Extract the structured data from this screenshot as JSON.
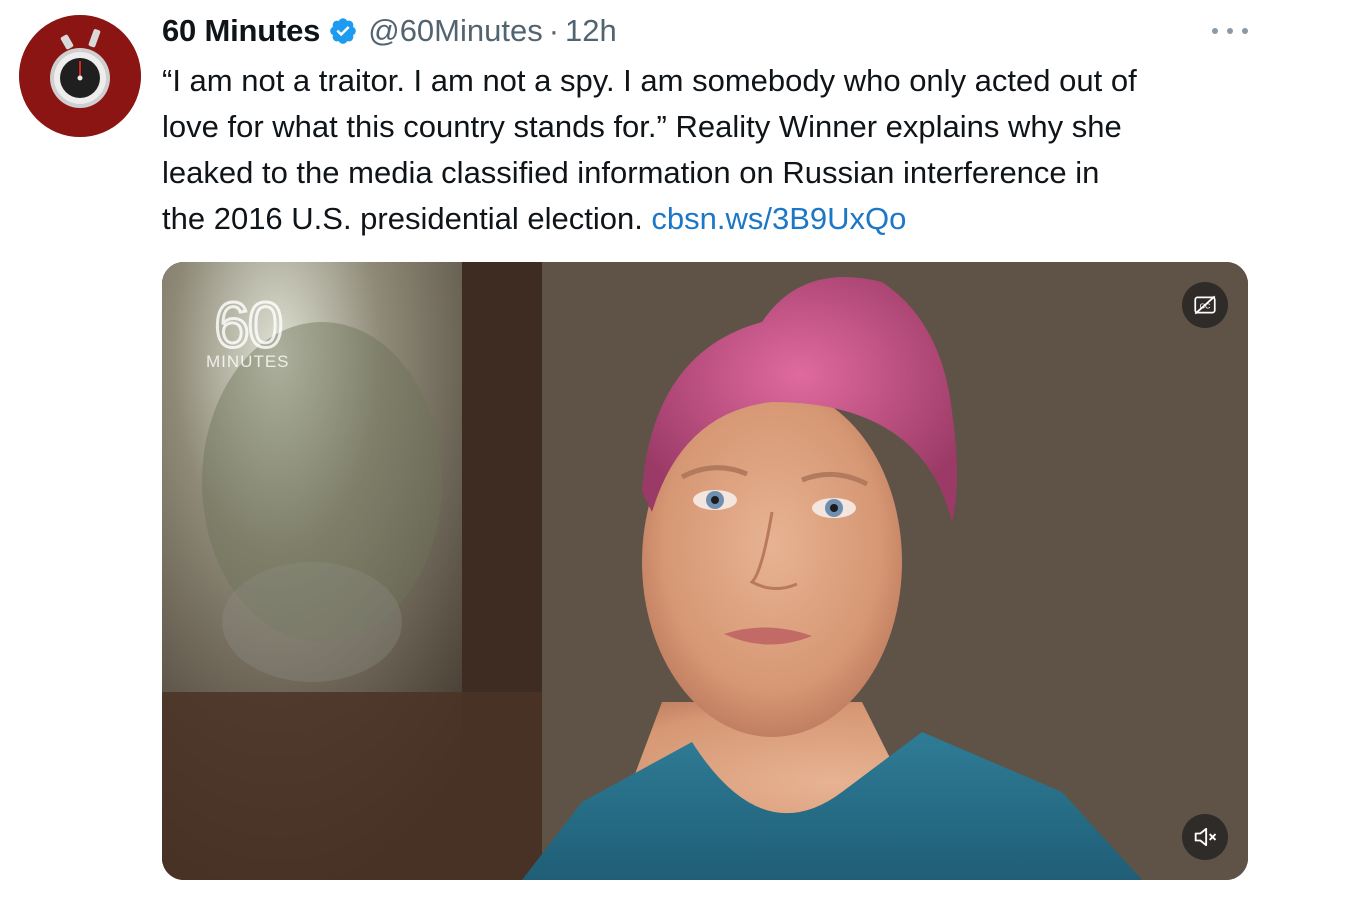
{
  "account": {
    "display_name": "60 Minutes",
    "handle": "@60Minutes",
    "separator": "·",
    "time": "12h",
    "avatar_icon": "stopwatch-icon",
    "verified_icon": "verified-badge-icon"
  },
  "tweet": {
    "lines": [
      "“I am not a traitor. I am not a spy. I am somebody who only acted out of",
      "love for what this country stands for.” Reality Winner explains why she",
      "leaked to the media classified information on Russian interference in",
      "the 2016 U.S. presidential election. "
    ],
    "link": "cbsn.ws/3B9UxQo"
  },
  "media": {
    "logo_number": "60",
    "logo_word": "MINUTES",
    "captions_icon": "closed-captions-off-icon",
    "mute_icon": "muted-speaker-icon"
  },
  "colors": {
    "link": "#1d77c7",
    "secondary_text": "#536471",
    "verified": "#1d9bf0",
    "avatar_bg": "#8a1512"
  }
}
